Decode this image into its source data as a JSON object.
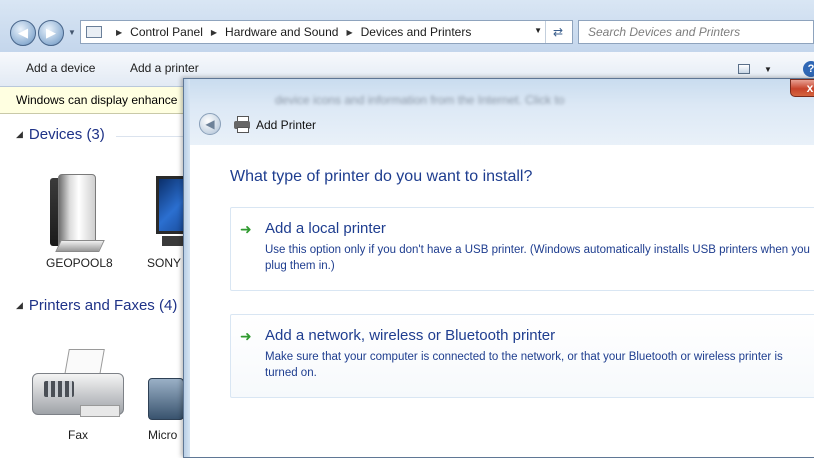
{
  "explorer": {
    "breadcrumbs": [
      "Control Panel",
      "Hardware and Sound",
      "Devices and Printers"
    ],
    "search_placeholder": "Search Devices and Printers",
    "toolbar": {
      "add_device": "Add a device",
      "add_printer": "Add a printer"
    },
    "infobar_text": "Windows can display enhance",
    "groups": {
      "devices": {
        "label": "Devices (3)"
      },
      "printers": {
        "label": "Printers and Faxes (4)"
      }
    },
    "devices": [
      "GEOPOOL8",
      "SONY"
    ],
    "printers": [
      "Fax",
      "Micro"
    ]
  },
  "dialog": {
    "title": "Add Printer",
    "blurred_infobar": "device icons and information from the Internet. Click to change...",
    "heading": "What type of printer do you want to install?",
    "options": [
      {
        "title": "Add a local printer",
        "description": "Use this option only if you don't have a USB printer. (Windows automatically installs USB printers when you plug them in.)"
      },
      {
        "title": "Add a network, wireless or Bluetooth printer",
        "description": "Make sure that your computer is connected to the network, or that your Bluetooth or wireless printer is turned on."
      }
    ]
  }
}
